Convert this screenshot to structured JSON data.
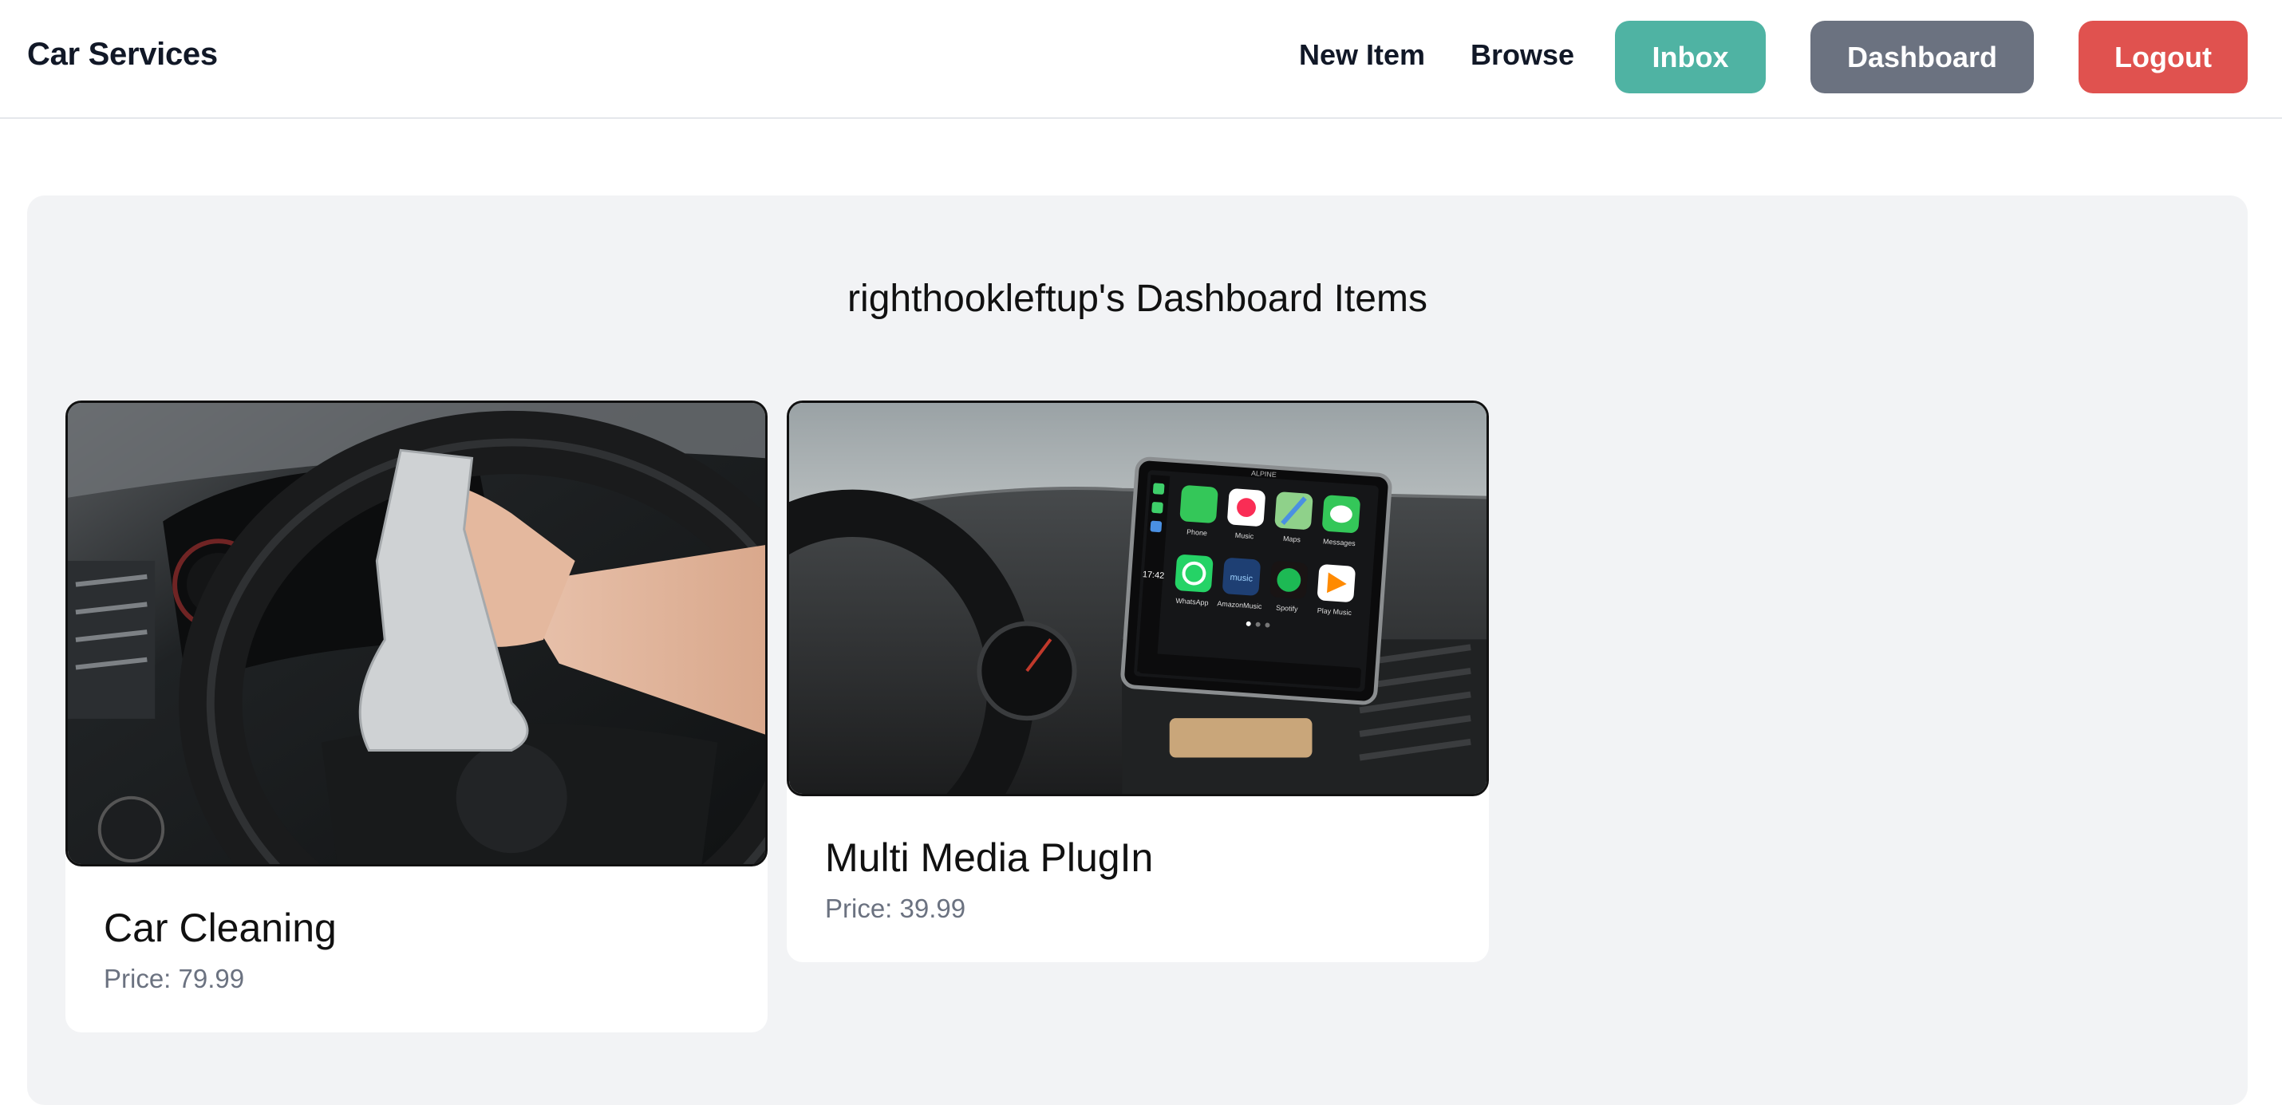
{
  "navbar": {
    "brand": "Car Services",
    "links": {
      "new_item": "New Item",
      "browse": "Browse"
    },
    "buttons": {
      "inbox": {
        "label": "Inbox",
        "color": "#4fb3a3"
      },
      "dashboard": {
        "label": "Dashboard",
        "color": "#6b7280"
      },
      "logout": {
        "label": "Logout",
        "color": "#e0524f"
      }
    }
  },
  "dashboard": {
    "title": "righthookleftup's Dashboard Items",
    "price_prefix": "Price: ",
    "items": [
      {
        "name": "Car Cleaning",
        "price": "79.99",
        "image_icon": "car-cleaning-photo"
      },
      {
        "name": "Multi Media PlugIn",
        "price": "39.99",
        "image_icon": "multimedia-head-unit-photo"
      }
    ],
    "head_unit_screen": {
      "apps": [
        "Phone",
        "Music",
        "Maps",
        "Messages",
        "WhatsApp",
        "AmazonMusic",
        "Spotify",
        "Play Music"
      ],
      "clock": "17:42",
      "brand_text": "ALPINE"
    }
  }
}
